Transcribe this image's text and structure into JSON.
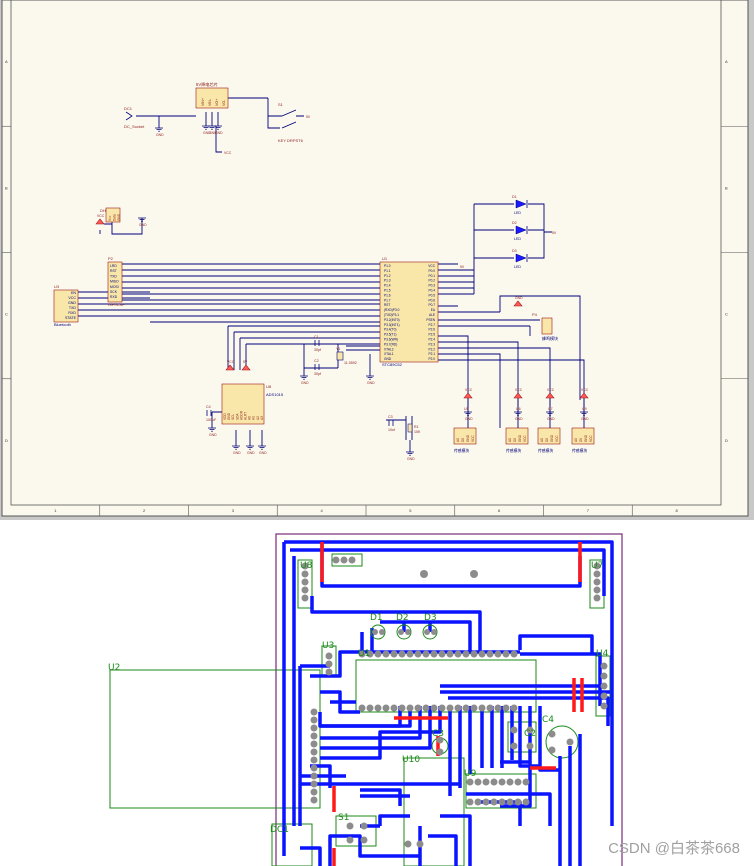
{
  "schematic": {
    "zone_numbers": [
      "1",
      "2",
      "3",
      "4",
      "5",
      "6",
      "7",
      "8"
    ],
    "zone_letters": [
      "A",
      "B",
      "C",
      "D"
    ],
    "colors": {
      "paper": "#fbf9ee",
      "wire": "#00007a",
      "part_fill": "#f8e7a8",
      "part_border": "#9a1414",
      "label": "#8b1a1a"
    },
    "power_chip": {
      "title": "5V降电芯片",
      "pins": [
        "VIN+",
        "VIN-",
        "VO+",
        "VO-"
      ]
    },
    "dc_socket": {
      "ref": "DC1",
      "name": "DC_Socket"
    },
    "switch": {
      "ref": "S1",
      "name": "KEY DRPST6"
    },
    "dht11": {
      "ref": "DHT11",
      "pins": [
        "Vcc",
        "Data",
        "GND"
      ]
    },
    "relay_header": {
      "ref": "P1",
      "name": "HC-05"
    },
    "bluetooth": {
      "ref": "U3",
      "name": "Bluetooth",
      "pins": [
        "EN",
        "VCC",
        "GND",
        "TXD",
        "RXD",
        "STATE"
      ]
    },
    "programmer": {
      "ref": "P2",
      "pins": [
        "LRD",
        "RST",
        "TXD",
        "MISO",
        "MOSI",
        "SCK",
        "RXD"
      ],
      "name": "ISP/ICSP"
    },
    "mcu": {
      "ref": "U1",
      "name": "STC89C52",
      "left_pins": [
        "P1.0",
        "P1.1",
        "P1.2",
        "P1.3",
        "P1.4",
        "P1.5",
        "P1.6",
        "P1.7",
        "RST",
        "(RXD)P3.0",
        "(TXD)P3.1",
        "P3.2(INT0)",
        "P3.3(INT1)",
        "P3.4(T0)",
        "P3.5(T1)",
        "P3.6(WR)",
        "P3.7(RD)",
        "XTAL2",
        "XTAL1",
        "GND"
      ],
      "right_pins": [
        "VCC",
        "P0.0",
        "P0.1",
        "P0.2",
        "P0.3",
        "P0.4",
        "P0.5",
        "P0.6",
        "P0.7",
        "EA",
        "ALE",
        "PSEN",
        "P2.7",
        "P2.6",
        "P2.5",
        "P2.4",
        "P2.3",
        "P2.2",
        "P2.1",
        "P2.0"
      ]
    },
    "leds": [
      {
        "ref": "D1",
        "name": "LED"
      },
      {
        "ref": "D2",
        "name": "LED"
      },
      {
        "ref": "D3",
        "name": "LED"
      }
    ],
    "crystal": {
      "ref": "Y1",
      "name": "11.0592"
    },
    "caps": [
      {
        "ref": "C1",
        "name": "30pf"
      },
      {
        "ref": "C2",
        "name": "30pf"
      },
      {
        "ref": "C3",
        "name": "10uf"
      },
      {
        "ref": "C4",
        "name": "100uF"
      }
    ],
    "resistor": {
      "ref": "R1",
      "name": "10K"
    },
    "lcd": {
      "ref": "U8",
      "name": "ADS1015",
      "pins": [
        "VDD",
        "GND",
        "SCL",
        "SDA",
        "ADDR",
        "ALRT",
        "A0",
        "A1",
        "A2",
        "A3"
      ]
    },
    "buzzer_header": {
      "ref": "P4",
      "name": "蜂鸣模块"
    },
    "sensor_modules": [
      {
        "ref": "U5",
        "name": "传感模块",
        "pins": [
          "A0",
          "D0",
          "GND",
          "VCC"
        ]
      },
      {
        "ref": "U6",
        "name": "传感模块",
        "pins": [
          "A0",
          "D0",
          "GND",
          "VCC"
        ]
      },
      {
        "ref": "U7",
        "name": "传感模块",
        "pins": [
          "A0",
          "D0",
          "GND",
          "VCC"
        ]
      },
      {
        "ref": "U9",
        "name": "传感模块",
        "pins": [
          "A0",
          "D0",
          "GND",
          "VCC"
        ]
      }
    ],
    "net_labels": {
      "gnd": "GND",
      "vcc": "VCC",
      "v5": "5V"
    }
  },
  "pcb": {
    "colors": {
      "board_bg": "#ffffff",
      "top": "#0a14ff",
      "bottom": "#ff1a1a",
      "overlay": "#1a8a1a",
      "outline": "#7a2a7a",
      "pad": "#8c8c8c"
    },
    "designators": [
      "U8",
      "U7",
      "U4",
      "U3",
      "U2",
      "D1",
      "D2",
      "D3",
      "C4",
      "C2",
      "C3",
      "U10",
      "U9",
      "S1",
      "DC1",
      "U1"
    ]
  },
  "watermark": "CSDN @白茶茶668"
}
